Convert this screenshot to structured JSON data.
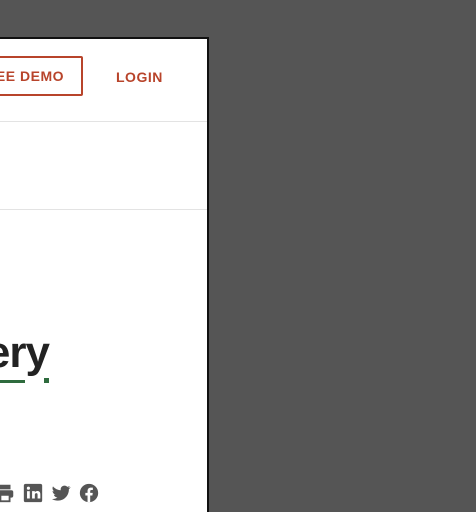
{
  "header": {
    "demo_label": "SEE DEMO",
    "login_label": "LOGIN"
  },
  "hero": {
    "headline": "ery"
  },
  "share": {
    "icons": [
      "print-icon",
      "linkedin-icon",
      "twitter-icon",
      "facebook-icon"
    ]
  },
  "colors": {
    "accent": "#b8442b",
    "backdrop": "#555555",
    "underline": "#2e6b3e"
  }
}
